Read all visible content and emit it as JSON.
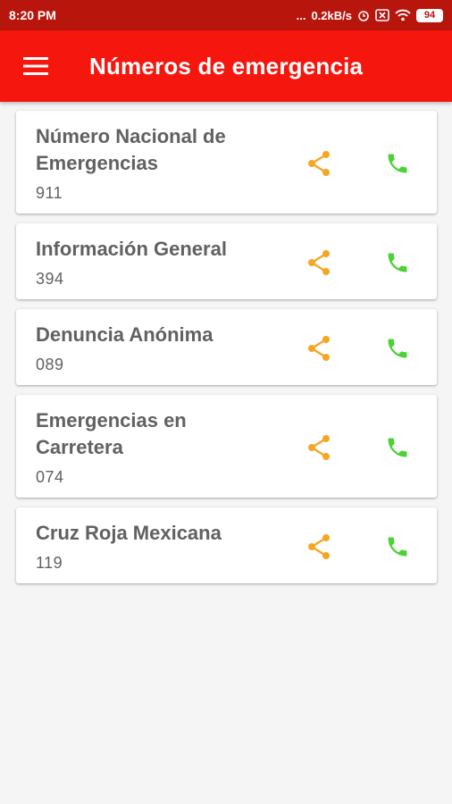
{
  "status_bar": {
    "time": "8:20 PM",
    "dots": "...",
    "speed": "0.2kB/s",
    "battery": "94"
  },
  "app_bar": {
    "title": "Números de emergencia",
    "menu_icon": "hamburger-menu-icon"
  },
  "colors": {
    "status_bar": "#b8150d",
    "app_bar": "#f5160e",
    "share_icon": "#f5a623",
    "call_icon": "#4cd137",
    "text": "#616161"
  },
  "contacts": [
    {
      "name": "Número Nacional de Emergencias",
      "number": "911"
    },
    {
      "name": "Información General",
      "number": "394"
    },
    {
      "name": "Denuncia Anónima",
      "number": "089"
    },
    {
      "name": "Emergencias en Carretera",
      "number": "074"
    },
    {
      "name": "Cruz Roja Mexicana",
      "number": "119"
    }
  ]
}
